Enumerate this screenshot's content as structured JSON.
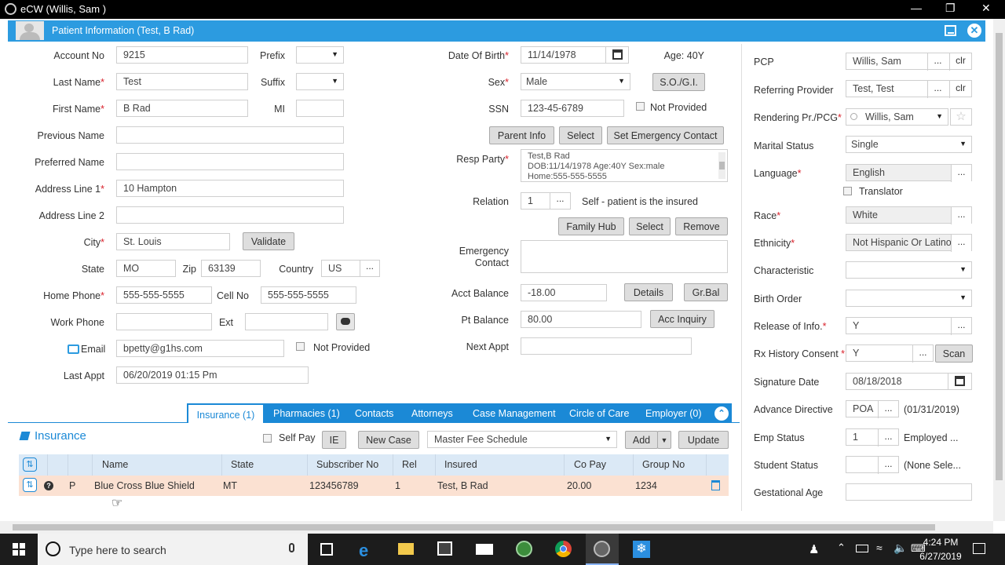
{
  "window": {
    "title": "eCW (Willis, Sam )"
  },
  "header": {
    "title": "Patient Information (Test, B Rad)"
  },
  "left": {
    "account_no_label": "Account No",
    "account_no": "9215",
    "prefix_label": "Prefix",
    "last_name_label": "Last Name",
    "last_name": "Test",
    "suffix_label": "Suffix",
    "first_name_label": "First Name",
    "first_name": "B Rad",
    "mi_label": "MI",
    "previous_name_label": "Previous Name",
    "preferred_name_label": "Preferred Name",
    "address1_label": "Address Line 1",
    "address1": "10 Hampton",
    "address2_label": "Address Line 2",
    "city_label": "City",
    "city": "St. Louis",
    "validate": "Validate",
    "state_label": "State",
    "state": "MO",
    "zip_label": "Zip",
    "zip": "63139",
    "country_label": "Country",
    "country": "US",
    "home_phone_label": "Home Phone",
    "home_phone": "555-555-5555",
    "cell_label": "Cell No",
    "cell": "555-555-5555",
    "work_phone_label": "Work Phone",
    "ext_label": "Ext",
    "email_label": "Email",
    "email": "bpetty@g1hs.com",
    "not_provided": "Not Provided",
    "last_appt_label": "Last Appt",
    "last_appt": "06/20/2019 01:15 Pm"
  },
  "middle": {
    "dob_label": "Date Of Birth",
    "dob": "11/14/1978",
    "age": "Age: 40Y",
    "sex_label": "Sex",
    "sex": "Male",
    "sogi": "S.O./G.I.",
    "ssn_label": "SSN",
    "ssn": "123-45-6789",
    "not_provided": "Not Provided",
    "parent_info": "Parent Info",
    "select": "Select",
    "set_emergency": "Set Emergency Contact",
    "resp_party_label": "Resp Party",
    "resp_line1": "Test,B Rad",
    "resp_line2": "DOB:11/14/1978 Age:40Y  Sex:male",
    "resp_line3": "Home:555-555-5555",
    "relation_label": "Relation",
    "relation": "1",
    "relation_text": "Self - patient is the insured",
    "family_hub": "Family Hub",
    "select2": "Select",
    "remove": "Remove",
    "emergency_label1": "Emergency",
    "emergency_label2": "Contact",
    "acct_balance_label": "Acct Balance",
    "acct_balance": "-18.00",
    "details": "Details",
    "grbal": "Gr.Bal",
    "pt_balance_label": "Pt Balance",
    "pt_balance": "80.00",
    "acc_inquiry": "Acc Inquiry",
    "next_appt_label": "Next Appt"
  },
  "right": {
    "pcp_label": "PCP",
    "pcp": "Willis, Sam",
    "clr": "clr",
    "referring_label": "Referring Provider",
    "referring": "Test, Test",
    "rendering_label": "Rendering Pr./PCG",
    "rendering": "Willis, Sam",
    "marital_label": "Marital Status",
    "marital": "Single",
    "language_label": "Language",
    "language": "English",
    "translator": "Translator",
    "race_label": "Race",
    "race": "White",
    "ethnicity_label": "Ethnicity",
    "ethnicity": "Not Hispanic Or Latino",
    "characteristic_label": "Characteristic",
    "birth_order_label": "Birth Order",
    "release_label": "Release of Info.",
    "release": "Y",
    "rx_label": "Rx History Consent",
    "rx": "Y",
    "scan": "Scan",
    "sig_date_label": "Signature Date",
    "sig_date": "08/18/2018",
    "adv_dir_label": "Advance Directive",
    "adv_dir": "POA",
    "adv_dir_date": "(01/31/2019)",
    "emp_status_label": "Emp Status",
    "emp_status": "1",
    "emp_status_text": "Employed ...",
    "student_label": "Student Status",
    "student_text": "(None Sele...",
    "gest_label": "Gestational Age"
  },
  "tabs": [
    "Insurance (1)",
    "Pharmacies (1)",
    "Contacts",
    "Attorneys",
    "Case Management",
    "Circle of Care",
    "Employer (0)"
  ],
  "insurance": {
    "title": "Insurance",
    "self_pay": "Self Pay",
    "ie": "IE",
    "new_case": "New Case",
    "fee_schedule": "Master Fee Schedule",
    "add": "Add",
    "update": "Update",
    "columns": [
      "Name",
      "State",
      "Subscriber No",
      "Rel",
      "Insured",
      "Co Pay",
      "Group No"
    ],
    "row": {
      "type": "P",
      "name": "Blue Cross Blue Shield",
      "state": "MT",
      "subscriber": "123456789",
      "rel": "1",
      "insured": "Test, B Rad",
      "copay": "20.00",
      "group": "1234"
    }
  },
  "taskbar": {
    "search_placeholder": "Type here to search",
    "time": "4:24 PM",
    "date": "6/27/2019"
  },
  "colors": {
    "header": "#2c9be0",
    "tabs": "#1b89d6",
    "required": "#d9232d",
    "row_highlight": "#fbe1d2"
  }
}
